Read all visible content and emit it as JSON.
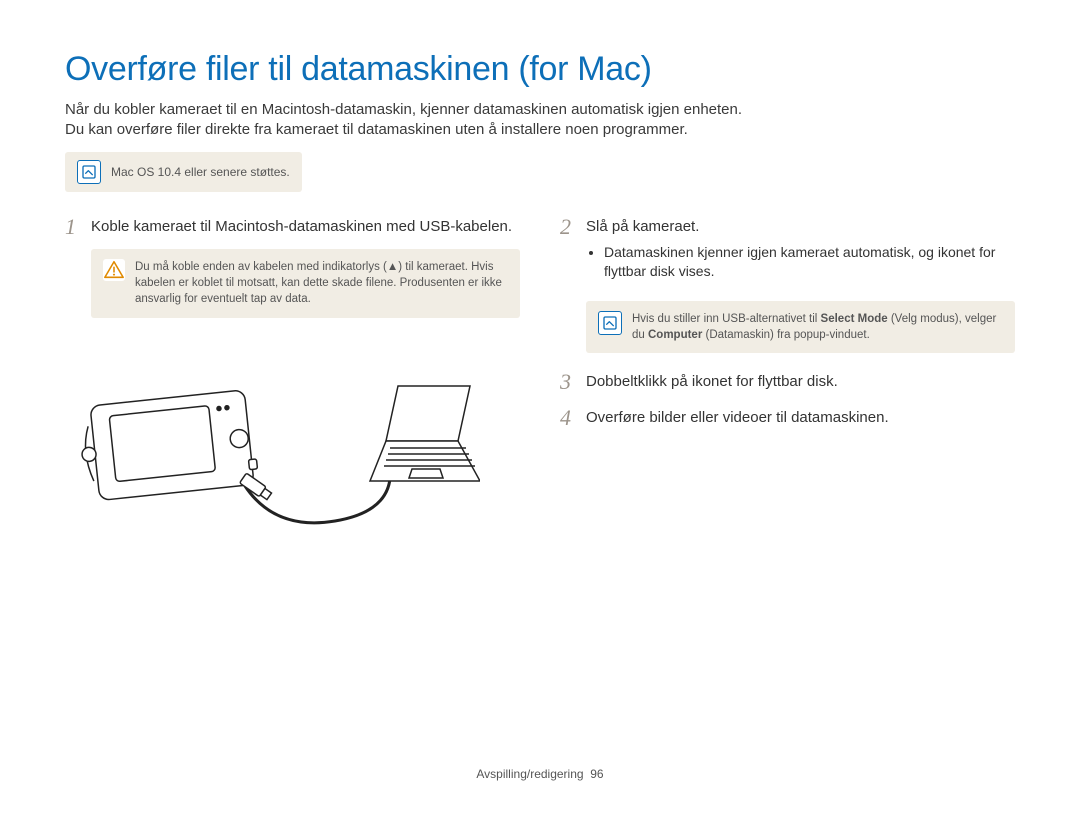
{
  "title": "Overføre filer til datamaskinen (for Mac)",
  "intro_line1": "Når du kobler kameraet til en Macintosh-datamaskin, kjenner datamaskinen automatisk igjen enheten.",
  "intro_line2": "Du kan overføre filer direkte fra kameraet til datamaskinen uten å installere noen programmer.",
  "top_note": "Mac OS 10.4 eller senere støttes.",
  "left": {
    "step1_num": "1",
    "step1_text": "Koble kameraet til Macintosh-datamaskinen med USB-kabelen.",
    "warn_text": "Du må koble enden av kabelen med indikatorlys (▲) til kameraet. Hvis kabelen er koblet til motsatt, kan dette skade filene. Produsenten er ikke ansvarlig for eventuelt tap av data."
  },
  "right": {
    "step2_num": "2",
    "step2_text": "Slå på kameraet.",
    "step2_bullet": "Datamaskinen kjenner igjen kameraet automatisk, og ikonet for flyttbar disk vises.",
    "info_text_pre": "Hvis du stiller inn USB-alternativet til ",
    "info_bold1": "Select Mode",
    "info_text_mid": " (Velg modus), velger du ",
    "info_bold2": "Computer",
    "info_text_post": " (Datamaskin) fra popup-vinduet.",
    "step3_num": "3",
    "step3_text": "Dobbeltklikk på ikonet for flyttbar disk.",
    "step4_num": "4",
    "step4_text": "Overføre bilder eller videoer til datamaskinen."
  },
  "footer_section": "Avspilling/redigering",
  "footer_page": "96"
}
